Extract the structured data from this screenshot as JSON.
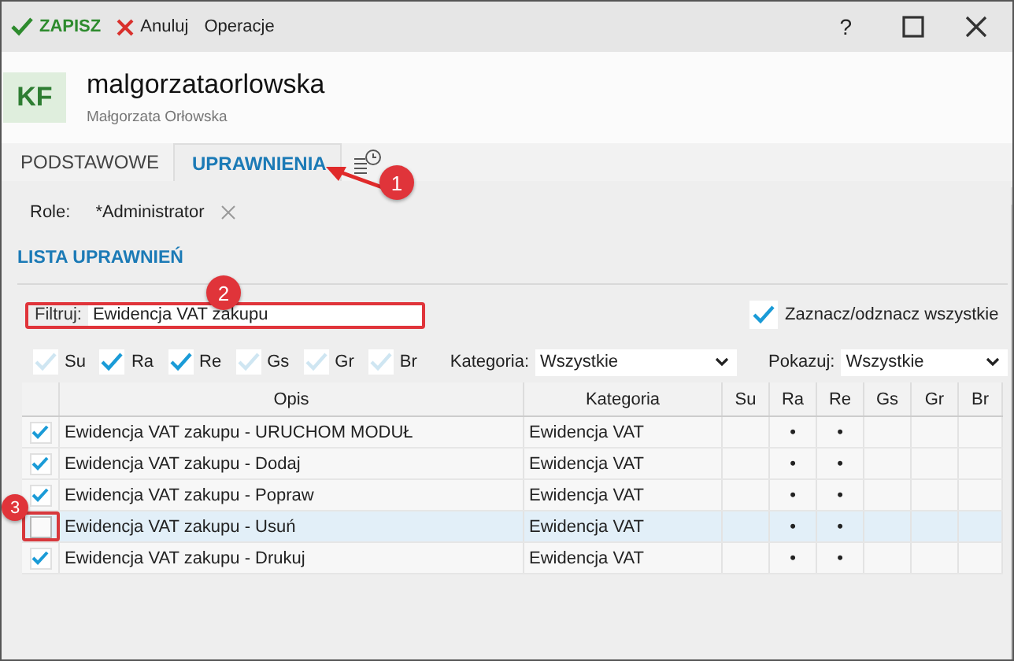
{
  "toolbar": {
    "save": "ZAPISZ",
    "cancel": "Anuluj",
    "operations": "Operacje",
    "help": "?"
  },
  "header": {
    "avatar": "KF",
    "login": "malgorzataorlowska",
    "full_name": "Małgorzata Orłowska"
  },
  "tabs": [
    {
      "label": "PODSTAWOWE",
      "selected": false
    },
    {
      "label": "UPRAWNIENIA",
      "selected": true
    }
  ],
  "roles": {
    "label": "Role:",
    "value": "*Administrator"
  },
  "section_title": "LISTA UPRAWNIEŃ",
  "filter": {
    "label": "Filtruj:",
    "value": "Ewidencja VAT zakupu",
    "highlighted": true
  },
  "select_all": {
    "label": "Zaznacz/odznacz wszystkie",
    "checked": true
  },
  "flag_filters": [
    {
      "label": "Su",
      "checked": false
    },
    {
      "label": "Ra",
      "checked": true
    },
    {
      "label": "Re",
      "checked": true
    },
    {
      "label": "Gs",
      "checked": false
    },
    {
      "label": "Gr",
      "checked": false
    },
    {
      "label": "Br",
      "checked": false
    }
  ],
  "category": {
    "label": "Kategoria:",
    "value": "Wszystkie"
  },
  "show": {
    "label": "Pokazuj:",
    "value": "Wszystkie"
  },
  "table": {
    "columns": [
      "Opis",
      "Kategoria",
      "Su",
      "Ra",
      "Re",
      "Gs",
      "Gr",
      "Br"
    ],
    "rows": [
      {
        "checked": true,
        "selected": false,
        "highlighted": false,
        "opis": "Ewidencja VAT zakupu - URUCHOM MODUŁ",
        "kategoria": "Ewidencja VAT",
        "ra": "•",
        "re": "•"
      },
      {
        "checked": true,
        "selected": false,
        "highlighted": false,
        "opis": "Ewidencja VAT zakupu - Dodaj",
        "kategoria": "Ewidencja VAT",
        "ra": "•",
        "re": "•"
      },
      {
        "checked": true,
        "selected": false,
        "highlighted": false,
        "opis": "Ewidencja VAT zakupu - Popraw",
        "kategoria": "Ewidencja VAT",
        "ra": "•",
        "re": "•"
      },
      {
        "checked": false,
        "selected": true,
        "highlighted": true,
        "opis": "Ewidencja VAT zakupu -  Usuń",
        "kategoria": "Ewidencja VAT",
        "ra": "•",
        "re": "•"
      },
      {
        "checked": true,
        "selected": false,
        "highlighted": false,
        "opis": "Ewidencja VAT zakupu - Drukuj",
        "kategoria": "Ewidencja VAT",
        "ra": "•",
        "re": "•"
      }
    ]
  },
  "annotations": [
    {
      "label": "1",
      "kind": "arrow"
    },
    {
      "label": "2",
      "kind": "badge"
    },
    {
      "label": "3",
      "kind": "badge"
    }
  ]
}
